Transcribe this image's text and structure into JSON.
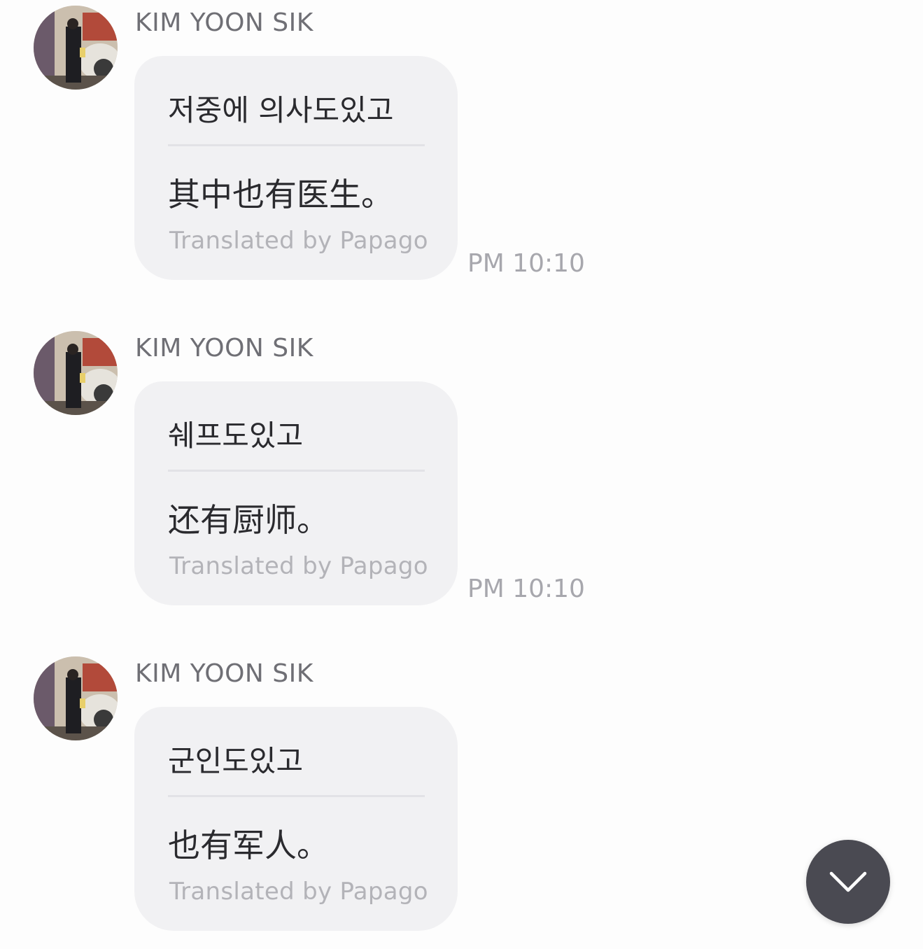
{
  "messages": [
    {
      "sender": "KIM YOON SIK",
      "original": "저중에 의사도있고",
      "translated": "其中也有医生。",
      "credit": "Translated by Papago",
      "time": "PM 10:10"
    },
    {
      "sender": "KIM YOON SIK",
      "original": "쉐프도있고",
      "translated": "还有厨师。",
      "credit": "Translated by Papago",
      "time": "PM 10:10"
    },
    {
      "sender": "KIM YOON SIK",
      "original": "군인도있고",
      "translated": "也有军人。",
      "credit": "Translated by Papago",
      "time": ""
    }
  ],
  "scroll_button": {
    "icon": "chevron-down-icon"
  },
  "colors": {
    "bubble": "#f1f1f3",
    "scroll_button": "#4a4a52",
    "sender_text": "#6f6f75",
    "credit_text": "#b3b3b8"
  }
}
